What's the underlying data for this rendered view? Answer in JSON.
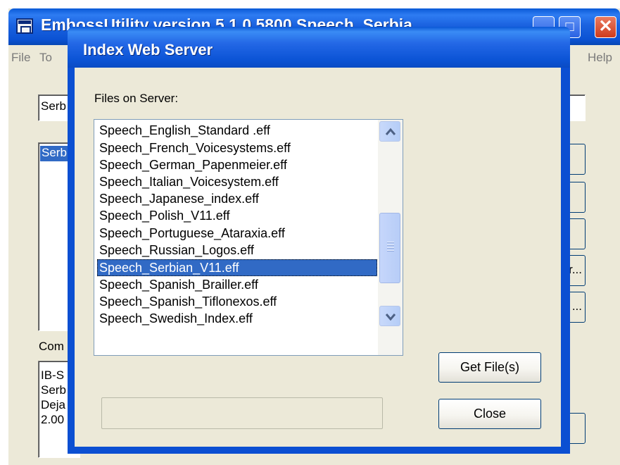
{
  "parent_window": {
    "title": "EmbossUtility version 5.1.0.5800 Speech_Serbia",
    "menu": {
      "file": "File",
      "tools": "To",
      "help": "Help"
    },
    "name_field_value": "Serb",
    "language_list_item": "Serb",
    "side_buttons": [
      "",
      "",
      "",
      "r...",
      "..."
    ],
    "comment_label": "Com",
    "comment_lines": [
      "IB-S",
      "Serb",
      "Deja",
      "2.00"
    ]
  },
  "dialog": {
    "title": "Index Web Server",
    "files_label": "Files on Server:",
    "files": [
      "Speech_English_Standard .eff",
      "Speech_French_Voicesystems.eff",
      "Speech_German_Papenmeier.eff",
      "Speech_Italian_Voicesystem.eff",
      "Speech_Japanese_index.eff",
      "Speech_Polish_V11.eff",
      "Speech_Portuguese_Ataraxia.eff",
      "Speech_Russian_Logos.eff",
      "Speech_Serbian_V11.eff",
      "Speech_Spanish_Brailler.eff",
      "Speech_Spanish_Tiflonexos.eff",
      "Speech_Swedish_Index.eff"
    ],
    "selected_file": "Speech_Serbian_V11.eff",
    "get_files_label": "Get File(s)",
    "close_label": "Close",
    "progress": 0
  },
  "colors": {
    "titlebar": "#0b52d3",
    "window_bg": "#ece9d8",
    "selection": "#316ac5"
  }
}
